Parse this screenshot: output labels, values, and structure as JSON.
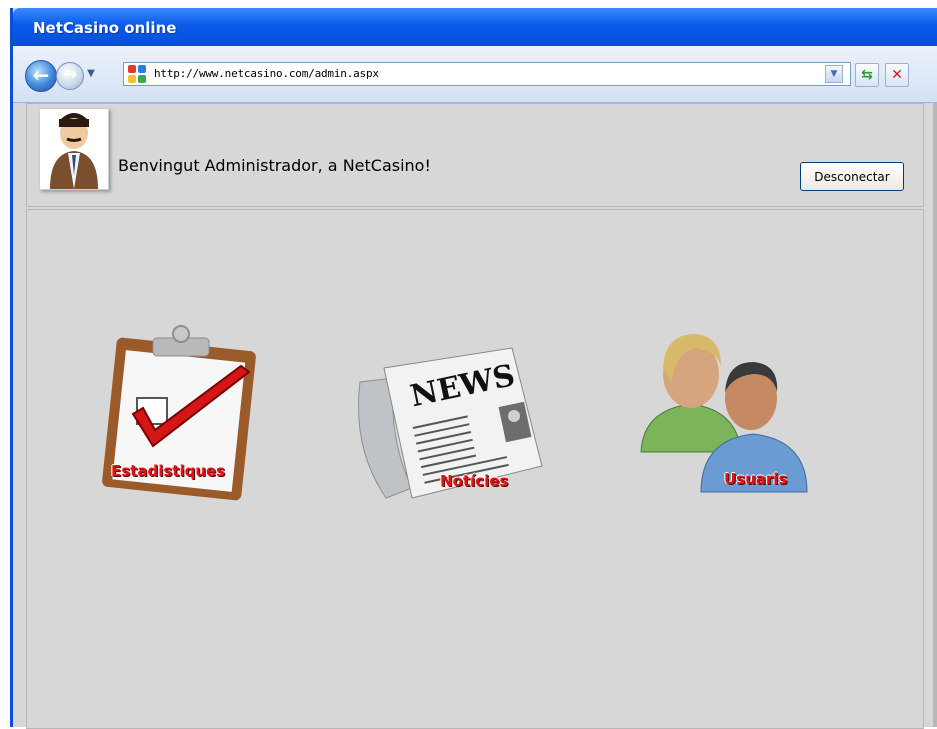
{
  "window": {
    "title": "NetCasino online"
  },
  "browser": {
    "url": "http://www.netcasino.com/admin.aspx",
    "icons": [
      "back-arrow-icon",
      "forward-arrow-icon",
      "history-dropdown-icon",
      "site-favicon",
      "address-dropdown-icon",
      "refresh-icon",
      "stop-icon"
    ]
  },
  "header": {
    "welcome_text": "Benvingut Administrador, a NetCasino!",
    "logout_label": "Desconectar",
    "avatar_icon": "administrator-avatar"
  },
  "menu": {
    "items": [
      {
        "label": "Estadistiques",
        "icon": "clipboard-checkmark-icon"
      },
      {
        "label": "Notícies",
        "icon": "newspaper-icon"
      },
      {
        "label": "Usuaris",
        "icon": "users-icon"
      }
    ]
  },
  "colors": {
    "titlebar": "#0a5ae8",
    "accent_red": "#e01515",
    "background": "#d7d7d7"
  }
}
